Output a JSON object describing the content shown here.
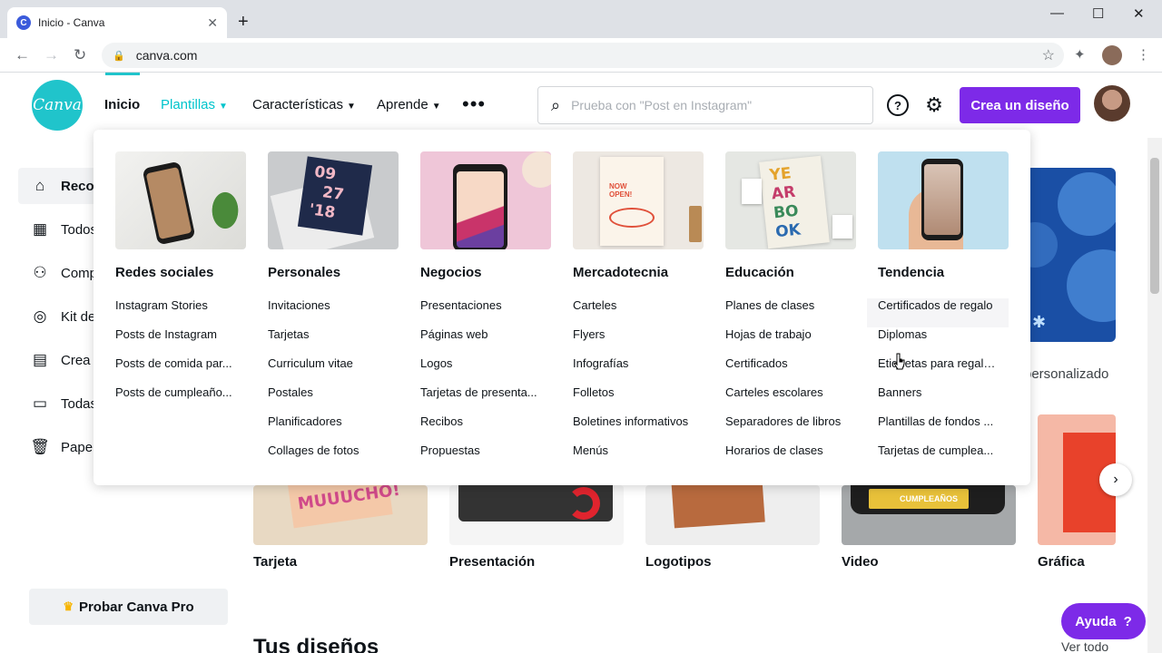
{
  "browser": {
    "tab_title": "Inicio - Canva",
    "favicon_letter": "C",
    "url": "canva.com"
  },
  "header": {
    "logo_text": "Canva",
    "nav": [
      {
        "label": "Inicio"
      },
      {
        "label": "Plantillas"
      },
      {
        "label": "Características"
      },
      {
        "label": "Aprende"
      }
    ],
    "search_placeholder": "Prueba con \"Post en Instagram\"",
    "create_button": "Crea un diseño"
  },
  "sidebar": {
    "items": [
      {
        "label": "Recomendado",
        "icon": "home-icon"
      },
      {
        "label": "Todos tus diseños",
        "icon": "grid-icon"
      },
      {
        "label": "Compartido contigo",
        "icon": "people-icon"
      },
      {
        "label": "Kit de marca",
        "icon": "brand-kit-icon"
      },
      {
        "label": "Crea un equipo",
        "icon": "building-icon"
      },
      {
        "label": "Todas tus carpetas",
        "icon": "folder-icon"
      },
      {
        "label": "Papelera",
        "icon": "trash-icon"
      }
    ],
    "pro_button": "Probar Canva Pro"
  },
  "mega_menu": {
    "columns": [
      {
        "heading": "Redes sociales",
        "items": [
          "Instagram Stories",
          "Posts de Instagram",
          "Posts de comida par...",
          "Posts de cumpleaño..."
        ]
      },
      {
        "heading": "Personales",
        "items": [
          "Invitaciones",
          "Tarjetas",
          "Curriculum vitae",
          "Postales",
          "Planificadores",
          "Collages de fotos"
        ]
      },
      {
        "heading": "Negocios",
        "items": [
          "Presentaciones",
          "Páginas web",
          "Logos",
          "Tarjetas de presenta...",
          "Recibos",
          "Propuestas"
        ]
      },
      {
        "heading": "Mercadotecnia",
        "items": [
          "Carteles",
          "Flyers",
          "Infografías",
          "Folletos",
          "Boletines informativos",
          "Menús"
        ]
      },
      {
        "heading": "Educación",
        "items": [
          "Planes de clases",
          "Hojas de trabajo",
          "Certificados",
          "Carteles escolares",
          "Separadores de libros",
          "Horarios de clases"
        ]
      },
      {
        "heading": "Tendencia",
        "items": [
          "Certificados de regalo",
          "Diplomas",
          "Etiquetas para regalos",
          "Banners",
          "Plantillas de fondos ...",
          "Tarjetas de cumplea..."
        ]
      }
    ]
  },
  "content": {
    "hero_label": "personalizado",
    "thumbnails": [
      {
        "label": "Tarjeta"
      },
      {
        "label": "Presentación"
      },
      {
        "label": "Logotipos"
      },
      {
        "label": "Video"
      },
      {
        "label": "Gráfica"
      }
    ],
    "section_title": "Tus diseños",
    "see_all": "Ver todo",
    "help_button": "Ayuda",
    "help_mark": "?"
  },
  "colors": {
    "brand_purple": "#7d2ae8",
    "brand_teal": "#20c4cb"
  }
}
